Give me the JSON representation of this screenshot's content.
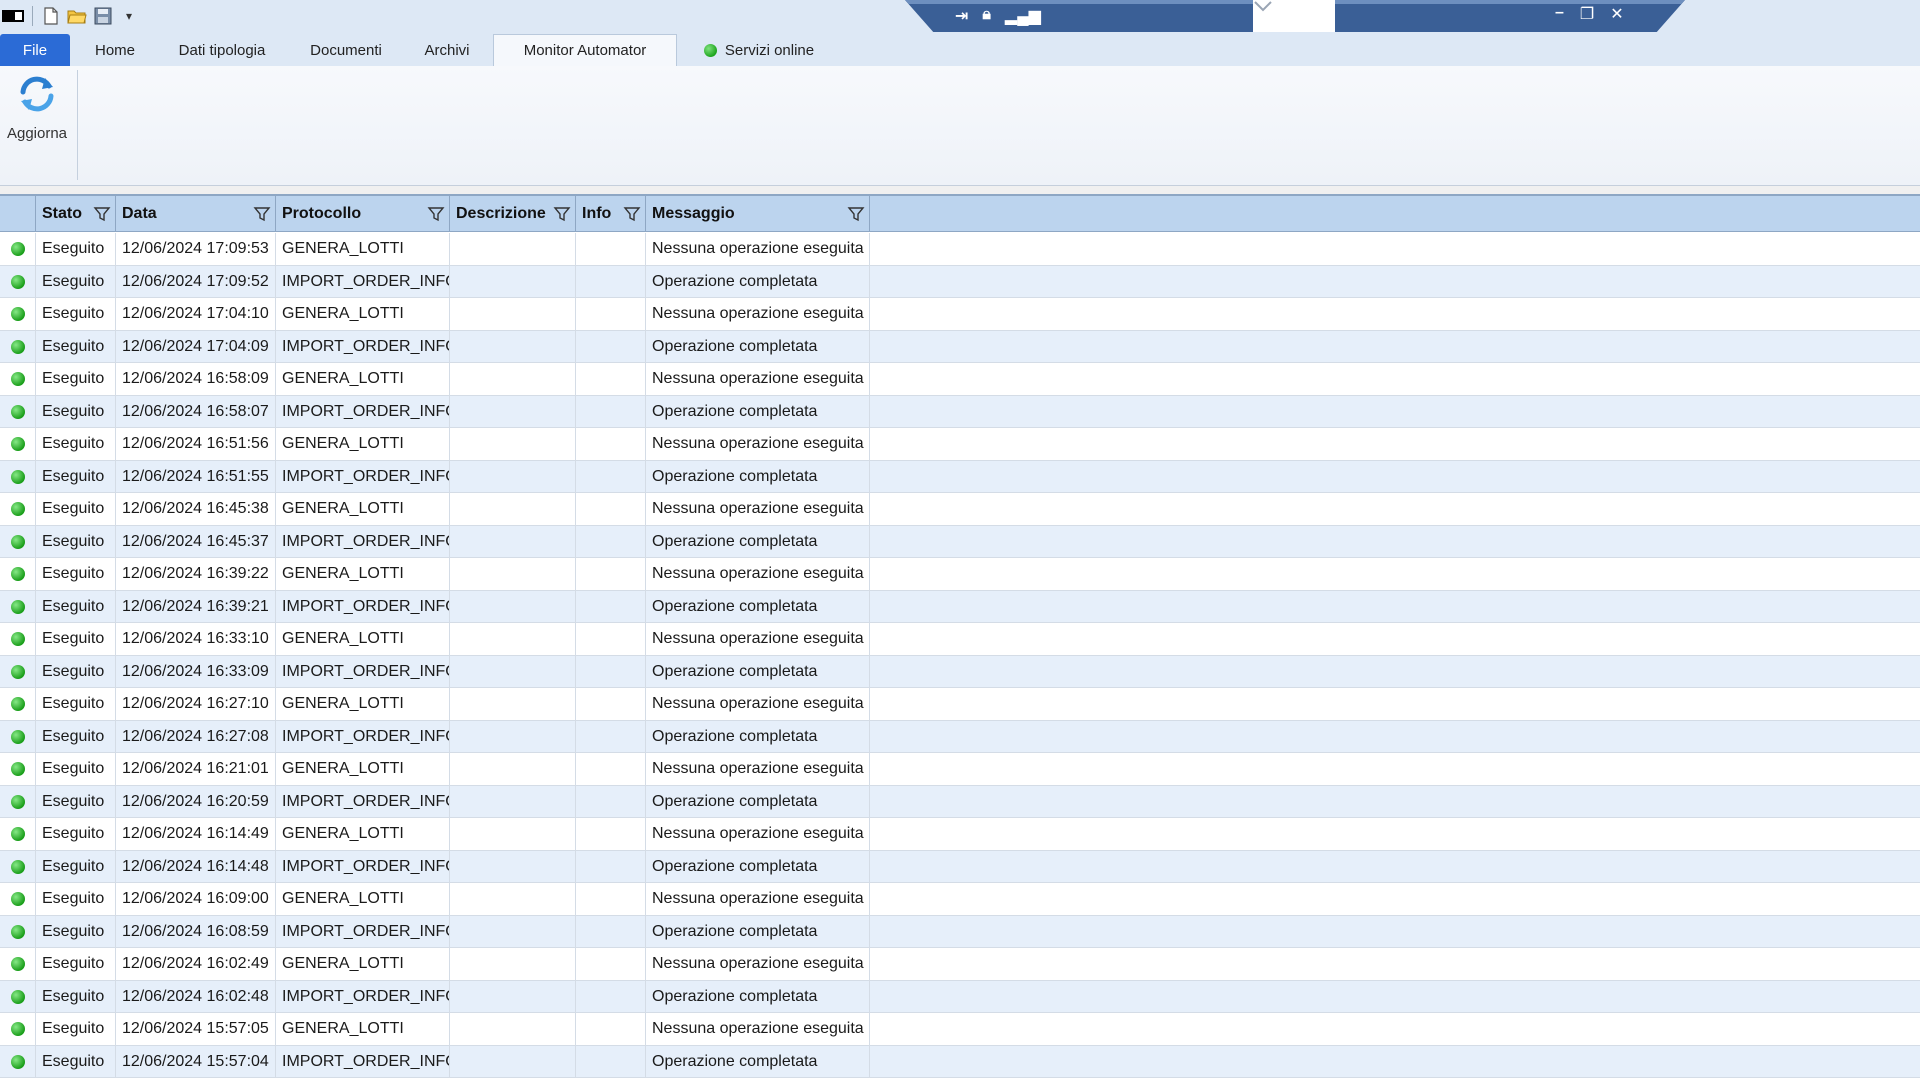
{
  "ribbon": {
    "tabs": [
      {
        "label": "File"
      },
      {
        "label": "Home"
      },
      {
        "label": "Dati tipologia"
      },
      {
        "label": "Documenti"
      },
      {
        "label": "Archivi"
      },
      {
        "label": "Monitor  Automator"
      },
      {
        "label": "Servizi online"
      }
    ],
    "active_tab": "Monitor  Automator",
    "refresh_label": "Aggiorna"
  },
  "grid": {
    "columns": [
      "Stato",
      "Data",
      "Protocollo",
      "Descrizione",
      "Info",
      "Messaggio"
    ],
    "rows": [
      {
        "stato": "Eseguito",
        "data": "12/06/2024 17:09:53",
        "protocollo": "GENERA_LOTTI",
        "descrizione": "",
        "info": "",
        "messaggio": "Nessuna operazione eseguita"
      },
      {
        "stato": "Eseguito",
        "data": "12/06/2024 17:09:52",
        "protocollo": "IMPORT_ORDER_INFO",
        "descrizione": "",
        "info": "",
        "messaggio": "Operazione completata"
      },
      {
        "stato": "Eseguito",
        "data": "12/06/2024 17:04:10",
        "protocollo": "GENERA_LOTTI",
        "descrizione": "",
        "info": "",
        "messaggio": "Nessuna operazione eseguita"
      },
      {
        "stato": "Eseguito",
        "data": "12/06/2024 17:04:09",
        "protocollo": "IMPORT_ORDER_INFO",
        "descrizione": "",
        "info": "",
        "messaggio": "Operazione completata"
      },
      {
        "stato": "Eseguito",
        "data": "12/06/2024 16:58:09",
        "protocollo": "GENERA_LOTTI",
        "descrizione": "",
        "info": "",
        "messaggio": "Nessuna operazione eseguita"
      },
      {
        "stato": "Eseguito",
        "data": "12/06/2024 16:58:07",
        "protocollo": "IMPORT_ORDER_INFO",
        "descrizione": "",
        "info": "",
        "messaggio": "Operazione completata"
      },
      {
        "stato": "Eseguito",
        "data": "12/06/2024 16:51:56",
        "protocollo": "GENERA_LOTTI",
        "descrizione": "",
        "info": "",
        "messaggio": "Nessuna operazione eseguita"
      },
      {
        "stato": "Eseguito",
        "data": "12/06/2024 16:51:55",
        "protocollo": "IMPORT_ORDER_INFO",
        "descrizione": "",
        "info": "",
        "messaggio": "Operazione completata"
      },
      {
        "stato": "Eseguito",
        "data": "12/06/2024 16:45:38",
        "protocollo": "GENERA_LOTTI",
        "descrizione": "",
        "info": "",
        "messaggio": "Nessuna operazione eseguita"
      },
      {
        "stato": "Eseguito",
        "data": "12/06/2024 16:45:37",
        "protocollo": "IMPORT_ORDER_INFO",
        "descrizione": "",
        "info": "",
        "messaggio": "Operazione completata"
      },
      {
        "stato": "Eseguito",
        "data": "12/06/2024 16:39:22",
        "protocollo": "GENERA_LOTTI",
        "descrizione": "",
        "info": "",
        "messaggio": "Nessuna operazione eseguita"
      },
      {
        "stato": "Eseguito",
        "data": "12/06/2024 16:39:21",
        "protocollo": "IMPORT_ORDER_INFO",
        "descrizione": "",
        "info": "",
        "messaggio": "Operazione completata"
      },
      {
        "stato": "Eseguito",
        "data": "12/06/2024 16:33:10",
        "protocollo": "GENERA_LOTTI",
        "descrizione": "",
        "info": "",
        "messaggio": "Nessuna operazione eseguita"
      },
      {
        "stato": "Eseguito",
        "data": "12/06/2024 16:33:09",
        "protocollo": "IMPORT_ORDER_INFO",
        "descrizione": "",
        "info": "",
        "messaggio": "Operazione completata"
      },
      {
        "stato": "Eseguito",
        "data": "12/06/2024 16:27:10",
        "protocollo": "GENERA_LOTTI",
        "descrizione": "",
        "info": "",
        "messaggio": "Nessuna operazione eseguita"
      },
      {
        "stato": "Eseguito",
        "data": "12/06/2024 16:27:08",
        "protocollo": "IMPORT_ORDER_INFO",
        "descrizione": "",
        "info": "",
        "messaggio": "Operazione completata"
      },
      {
        "stato": "Eseguito",
        "data": "12/06/2024 16:21:01",
        "protocollo": "GENERA_LOTTI",
        "descrizione": "",
        "info": "",
        "messaggio": "Nessuna operazione eseguita"
      },
      {
        "stato": "Eseguito",
        "data": "12/06/2024 16:20:59",
        "protocollo": "IMPORT_ORDER_INFO",
        "descrizione": "",
        "info": "",
        "messaggio": "Operazione completata"
      },
      {
        "stato": "Eseguito",
        "data": "12/06/2024 16:14:49",
        "protocollo": "GENERA_LOTTI",
        "descrizione": "",
        "info": "",
        "messaggio": "Nessuna operazione eseguita"
      },
      {
        "stato": "Eseguito",
        "data": "12/06/2024 16:14:48",
        "protocollo": "IMPORT_ORDER_INFO",
        "descrizione": "",
        "info": "",
        "messaggio": "Operazione completata"
      },
      {
        "stato": "Eseguito",
        "data": "12/06/2024 16:09:00",
        "protocollo": "GENERA_LOTTI",
        "descrizione": "",
        "info": "",
        "messaggio": "Nessuna operazione eseguita"
      },
      {
        "stato": "Eseguito",
        "data": "12/06/2024 16:08:59",
        "protocollo": "IMPORT_ORDER_INFO",
        "descrizione": "",
        "info": "",
        "messaggio": "Operazione completata"
      },
      {
        "stato": "Eseguito",
        "data": "12/06/2024 16:02:49",
        "protocollo": "GENERA_LOTTI",
        "descrizione": "",
        "info": "",
        "messaggio": "Nessuna operazione eseguita"
      },
      {
        "stato": "Eseguito",
        "data": "12/06/2024 16:02:48",
        "protocollo": "IMPORT_ORDER_INFO",
        "descrizione": "",
        "info": "",
        "messaggio": "Operazione completata"
      },
      {
        "stato": "Eseguito",
        "data": "12/06/2024 15:57:05",
        "protocollo": "GENERA_LOTTI",
        "descrizione": "",
        "info": "",
        "messaggio": "Nessuna operazione eseguita"
      },
      {
        "stato": "Eseguito",
        "data": "12/06/2024 15:57:04",
        "protocollo": "IMPORT_ORDER_INFO",
        "descrizione": "",
        "info": "",
        "messaggio": "Operazione completata"
      }
    ]
  },
  "colors": {
    "file_tab": "#2b6bd6",
    "header_bg": "#bcd4ee",
    "alt_row": "#e6effa",
    "status_ok": "#1ea51e"
  },
  "icons": {
    "status": "green-dot-icon",
    "filter": "filter-icon",
    "refresh": "refresh-icon"
  }
}
